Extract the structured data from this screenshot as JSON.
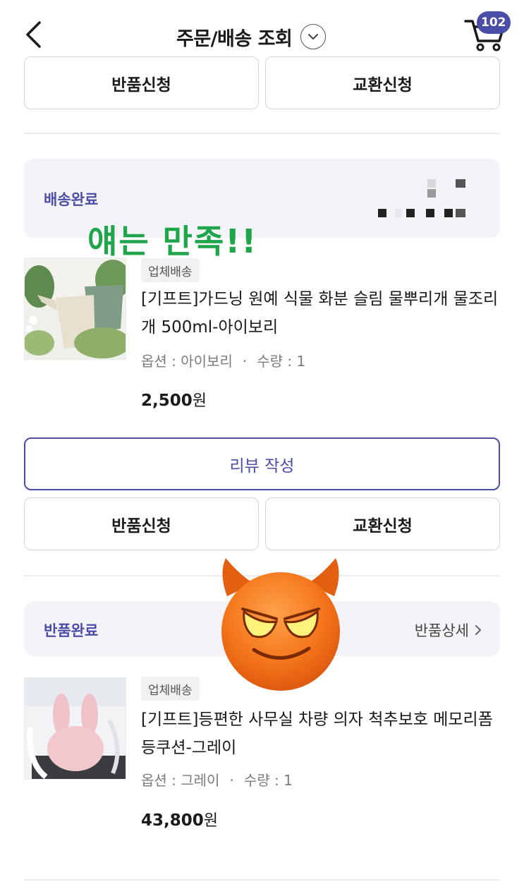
{
  "header": {
    "title": "주문/배송 조회",
    "cart_count": "102"
  },
  "top_actions": {
    "return_label": "반품신청",
    "exchange_label": "교환신청"
  },
  "orders": [
    {
      "status": "배송완료",
      "annotation": "얘는 만족!!",
      "shipping_type": "업체배송",
      "product_name": "[기프트]가드닝 원예 식물 화분 슬림 물뿌리개 물조리개 500ml-아이보리",
      "option_label": "옵션 : 아이보리",
      "quantity_label": "수량 : 1",
      "price_value": "2,500",
      "price_unit": "원",
      "review_label": "리뷰 작성",
      "return_label": "반품신청",
      "exchange_label": "교환신청"
    },
    {
      "status": "반품완료",
      "detail_link": "반품상세",
      "shipping_type": "업체배송",
      "product_name": "[기프트]등편한 사무실 차량 의자 척추보호 메모리폼 등쿠션-그레이",
      "option_label": "옵션 : 그레이",
      "quantity_label": "수량 : 1",
      "price_value": "43,800",
      "price_unit": "원"
    }
  ],
  "icons": {
    "back": "back-arrow-icon",
    "dropdown": "chevron-down-icon",
    "cart": "cart-icon",
    "detail": "chevron-right-icon",
    "sticker": "devil-emoji-icon"
  },
  "colors": {
    "accent": "#4b4ea8",
    "annotation": "#1fa64b",
    "status_bg": "#f4f4f8"
  }
}
